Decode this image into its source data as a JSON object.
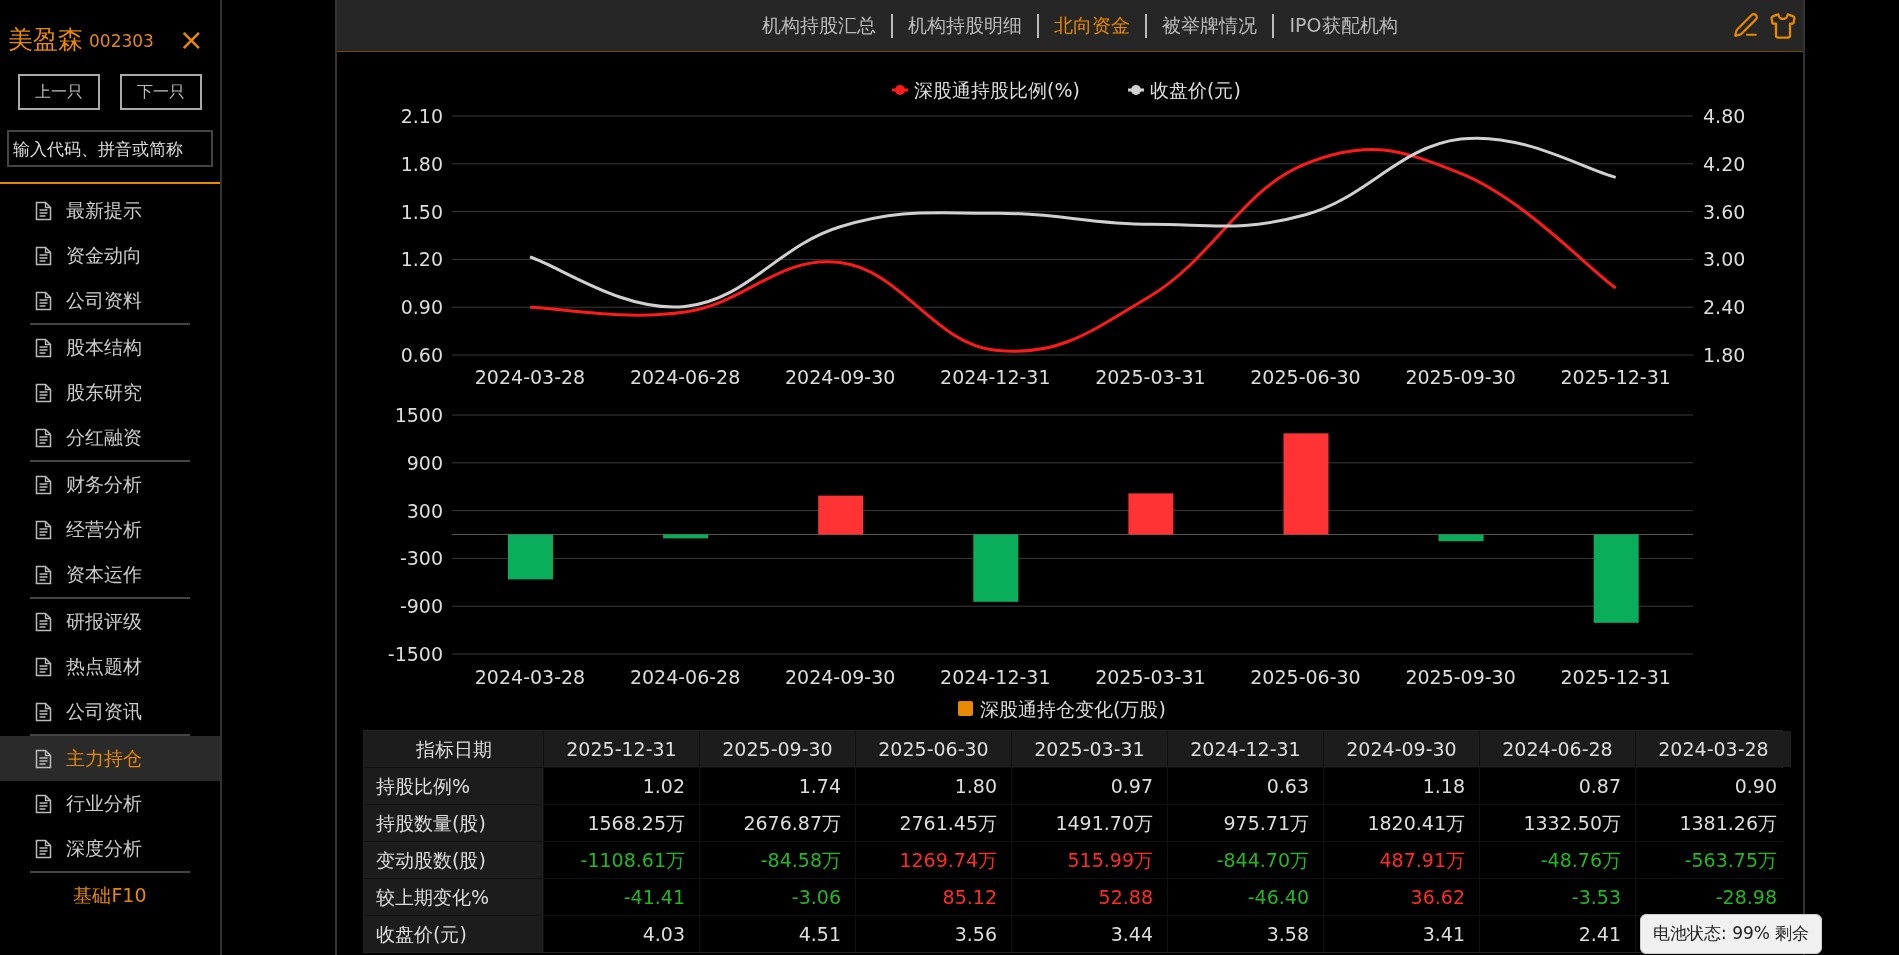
{
  "stock": {
    "name": "美盈森",
    "code": "002303",
    "close": "×"
  },
  "nav_buttons": [
    "上一只",
    "下一只"
  ],
  "search": {
    "placeholder": "输入代码、拼音或简称"
  },
  "menu_groups": [
    {
      "items": [
        {
          "label": "最新提示",
          "selected": false
        },
        {
          "label": "资金动向",
          "selected": false
        },
        {
          "label": "公司资料",
          "selected": false
        }
      ]
    },
    {
      "items": [
        {
          "label": "股本结构",
          "selected": false
        },
        {
          "label": "股东研究",
          "selected": false
        },
        {
          "label": "分红融资",
          "selected": false
        }
      ]
    },
    {
      "items": [
        {
          "label": "财务分析",
          "selected": false
        },
        {
          "label": "经营分析",
          "selected": false
        },
        {
          "label": "资本运作",
          "selected": false
        }
      ]
    },
    {
      "items": [
        {
          "label": "研报评级",
          "selected": false
        },
        {
          "label": "热点题材",
          "selected": false
        },
        {
          "label": "公司资讯",
          "selected": false
        }
      ]
    },
    {
      "items": [
        {
          "label": "主力持仓",
          "selected": true
        },
        {
          "label": "行业分析",
          "selected": false
        },
        {
          "label": "深度分析",
          "selected": false
        }
      ]
    }
  ],
  "footer_link": "基础F10",
  "tabs": [
    {
      "label": "机构持股汇总",
      "selected": false
    },
    {
      "label": "机构持股明细",
      "selected": false
    },
    {
      "label": "北向资金",
      "selected": true
    },
    {
      "label": "被举牌情况",
      "selected": false
    },
    {
      "label": "IPO获配机构",
      "selected": false
    }
  ],
  "line_chart": {
    "chart_data": {
      "type": "line",
      "grid": true,
      "legend": "top",
      "ylim": [
        0.6,
        2.1
      ],
      "y2lim": [
        1.8,
        4.8
      ],
      "categories": [
        "2024-03-28",
        "2024-06-28",
        "2024-09-30",
        "2024-12-31",
        "2025-03-31",
        "2025-06-30",
        "2025-09-30",
        "2025-12-31"
      ],
      "series": [
        {
          "name": "深股通持股比例(%)",
          "color": "#ff1a1a",
          "values": [
            0.9,
            0.87,
            1.18,
            0.63,
            0.97,
            1.8,
            1.74,
            1.02
          ]
        },
        {
          "name": "收盘价(元)",
          "color": "#d0d0d0",
          "axis": "y2",
          "values": [
            3.03,
            2.41,
            3.41,
            3.58,
            3.44,
            3.56,
            4.51,
            4.03
          ]
        }
      ],
      "yticks": [
        {
          "value": 2.1,
          "label": "2.10"
        },
        {
          "value": 1.8,
          "label": "1.80"
        },
        {
          "value": 1.5,
          "label": "1.50"
        },
        {
          "value": 1.2,
          "label": "1.20"
        },
        {
          "value": 0.9,
          "label": "0.90"
        },
        {
          "value": 0.6,
          "label": "0.60"
        }
      ],
      "y2ticks": [
        {
          "value": 4.8,
          "label": "4.80"
        },
        {
          "value": 4.2,
          "label": "4.20"
        },
        {
          "value": 3.6,
          "label": "3.60"
        },
        {
          "value": 3.0,
          "label": "3.00"
        },
        {
          "value": 2.4,
          "label": "2.40"
        },
        {
          "value": 1.8,
          "label": "1.80"
        }
      ]
    }
  },
  "bar_chart": {
    "chart_data": {
      "type": "bar",
      "grid": true,
      "legend": "bottom",
      "categories": [
        "2024-03-28",
        "2024-06-28",
        "2024-09-30",
        "2024-12-31",
        "2025-03-31",
        "2025-06-30",
        "2025-09-30",
        "2025-12-31"
      ],
      "series": [
        {
          "name": "深股通持仓变化(万股)",
          "color": "#e88a00",
          "colors": [
            "#0aad5a",
            "#0aad5a",
            "#ff3333",
            "#0aad5a",
            "#ff3333",
            "#ff3333",
            "#0aad5a",
            "#0aad5a"
          ],
          "values": [
            -563.75,
            -48.76,
            487.91,
            -844.7,
            515.99,
            1269.74,
            -84.58,
            -1108.61
          ]
        }
      ],
      "ylim": [
        -1500,
        1500
      ],
      "yticks": [
        1500,
        900,
        300,
        -300,
        -900,
        -1500
      ]
    }
  },
  "table": {
    "columns": [
      "指标日期",
      "2025-12-31",
      "2025-09-30",
      "2025-06-30",
      "2025-03-31",
      "2024-12-31",
      "2024-09-30",
      "2024-06-28",
      "2024-03-28"
    ],
    "rows": [
      {
        "cells": [
          {
            "value": "持股比例%"
          },
          {
            "value": "1.02"
          },
          {
            "value": "1.74"
          },
          {
            "value": "1.80"
          },
          {
            "value": "0.97"
          },
          {
            "value": "0.63"
          },
          {
            "value": "1.18"
          },
          {
            "value": "0.87"
          },
          {
            "value": "0.90"
          }
        ]
      },
      {
        "cells": [
          {
            "value": "持股数量(股)"
          },
          {
            "value": "1568.25万"
          },
          {
            "value": "2676.87万"
          },
          {
            "value": "2761.45万"
          },
          {
            "value": "1491.70万"
          },
          {
            "value": "975.71万"
          },
          {
            "value": "1820.41万"
          },
          {
            "value": "1332.50万"
          },
          {
            "value": "1381.26万"
          }
        ]
      },
      {
        "cells": [
          {
            "value": "变动股数(股)"
          },
          {
            "value": "-1108.61万",
            "color": "#22b822"
          },
          {
            "value": "-84.58万",
            "color": "#22b822"
          },
          {
            "value": "1269.74万",
            "color": "#ff2a2a"
          },
          {
            "value": "515.99万",
            "color": "#ff2a2a"
          },
          {
            "value": "-844.70万",
            "color": "#22b822"
          },
          {
            "value": "487.91万",
            "color": "#ff2a2a"
          },
          {
            "value": "-48.76万",
            "color": "#22b822"
          },
          {
            "value": "-563.75万",
            "color": "#22b822"
          }
        ]
      },
      {
        "cells": [
          {
            "value": "较上期变化%"
          },
          {
            "value": "-41.41",
            "color": "#22b822"
          },
          {
            "value": "-3.06",
            "color": "#22b822"
          },
          {
            "value": "85.12",
            "color": "#ff2a2a"
          },
          {
            "value": "52.88",
            "color": "#ff2a2a"
          },
          {
            "value": "-46.40",
            "color": "#22b822"
          },
          {
            "value": "36.62",
            "color": "#ff2a2a"
          },
          {
            "value": "-3.53",
            "color": "#22b822"
          },
          {
            "value": "-28.98",
            "color": "#22b822"
          }
        ]
      },
      {
        "cells": [
          {
            "value": "收盘价(元)"
          },
          {
            "value": "4.03"
          },
          {
            "value": "4.51"
          },
          {
            "value": "3.56"
          },
          {
            "value": "3.44"
          },
          {
            "value": "3.58"
          },
          {
            "value": "3.41"
          },
          {
            "value": "2.41"
          }
        ]
      }
    ]
  },
  "tooltip": "电池状态: 99% 剩余"
}
